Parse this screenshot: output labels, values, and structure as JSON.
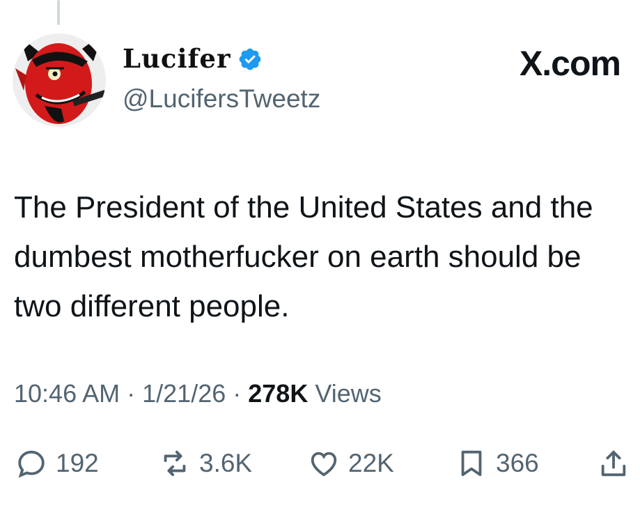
{
  "author": {
    "display_name": "Lucifer",
    "handle": "@LucifersTweetz",
    "verified": true
  },
  "site": {
    "logo_text": "X.com"
  },
  "tweet": {
    "text": "The President of the United States and the dumbest motherfucker on earth should be two different people.",
    "time": "10:46 AM",
    "date": "1/21/26",
    "views_count": "278K",
    "views_label": "Views"
  },
  "actions": {
    "replies": "192",
    "reposts": "3.6K",
    "likes": "22K",
    "bookmarks": "366"
  },
  "icons": [
    "reply-icon",
    "repost-icon",
    "like-icon",
    "bookmark-icon",
    "share-icon",
    "verified-badge-icon"
  ],
  "colors": {
    "verified": "#1d9bf0",
    "secondary_text": "#536471",
    "primary_text": "#0f1419"
  }
}
